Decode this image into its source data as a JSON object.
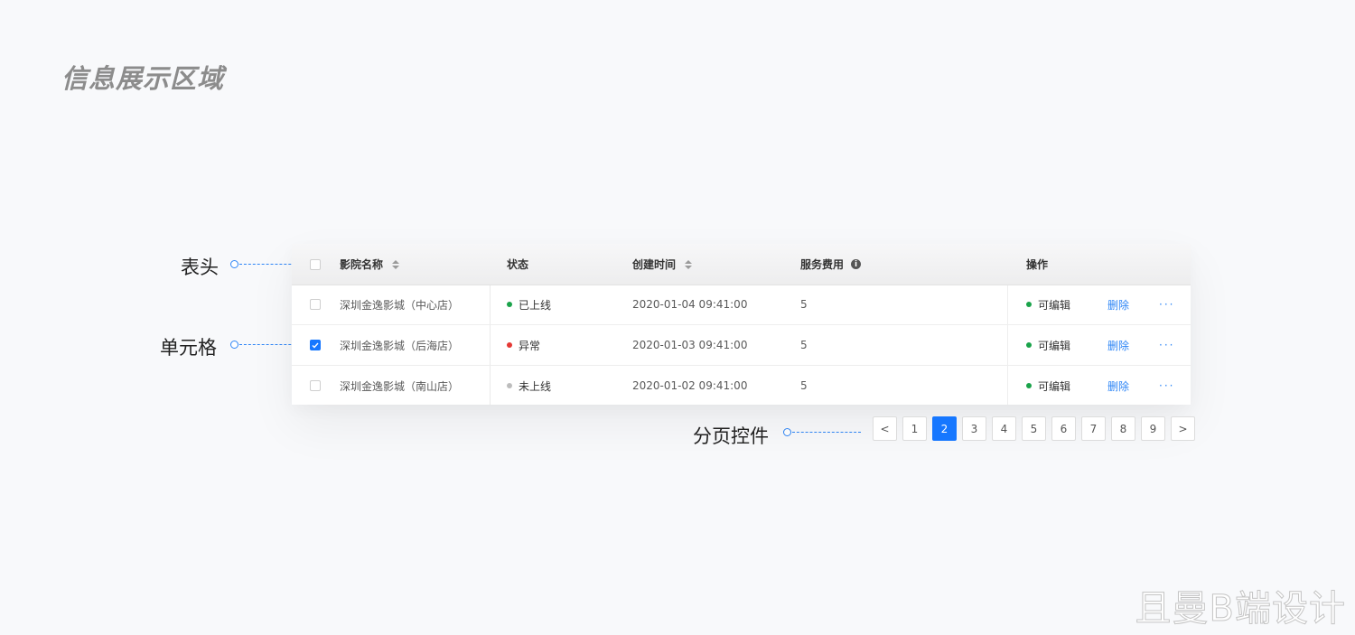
{
  "page_title": "信息展示区域",
  "watermark": "且曼B端设计",
  "annotations": {
    "header": "表头",
    "cell": "单元格",
    "pagination": "分页控件"
  },
  "table": {
    "columns": {
      "name": "影院名称",
      "status": "状态",
      "created": "创建时间",
      "fee": "服务费用",
      "action": "操作"
    },
    "rows": [
      {
        "checked": false,
        "name": "深圳金逸影城（中心店）",
        "status": "已上线",
        "status_color": "#1aa34a",
        "created": "2020-01-04  09:41:00",
        "fee": "5",
        "action_status": "可编辑",
        "delete": "删除",
        "more": "···"
      },
      {
        "checked": true,
        "name": "深圳金逸影城（后海店）",
        "status": "异常",
        "status_color": "#e53935",
        "created": "2020-01-03  09:41:00",
        "fee": "5",
        "action_status": "可编辑",
        "delete": "删除",
        "more": "···"
      },
      {
        "checked": false,
        "name": "深圳金逸影城（南山店）",
        "status": "未上线",
        "status_color": "#bdbdbd",
        "created": "2020-01-02  09:41:00",
        "fee": "5",
        "action_status": "可编辑",
        "delete": "删除",
        "more": "···"
      }
    ],
    "action_dot_color": "#1aa34a"
  },
  "pagination": {
    "prev": "<",
    "next": ">",
    "pages": [
      "1",
      "2",
      "3",
      "4",
      "5",
      "6",
      "7",
      "8",
      "9"
    ],
    "current": "2"
  },
  "colors": {
    "accent": "#1677ff",
    "link": "#2f86f6"
  }
}
